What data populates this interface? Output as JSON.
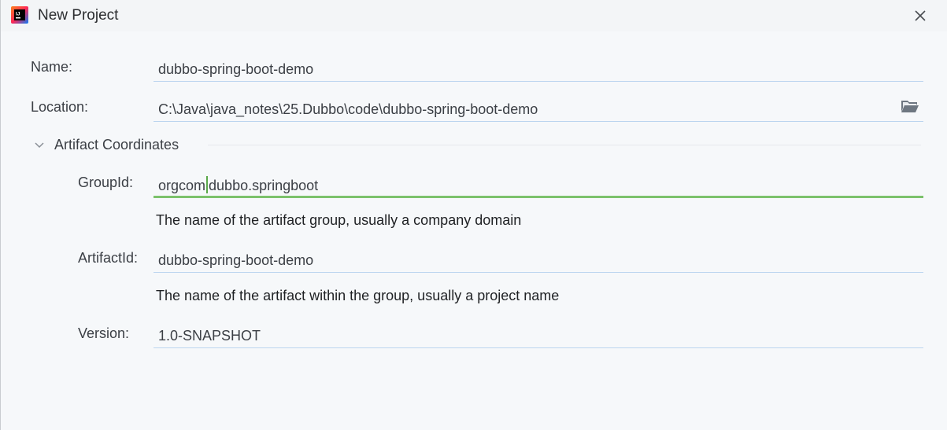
{
  "window": {
    "title": "New Project",
    "app_icon": "intellij-idea-icon",
    "close_icon": "close-icon"
  },
  "form": {
    "name_label": "Name:",
    "name_value": "dubbo-spring-boot-demo",
    "location_label": "Location:",
    "location_value": "C:\\Java\\java_notes\\25.Dubbo\\code\\dubbo-spring-boot-demo",
    "location_browse_icon": "folder-icon"
  },
  "artifact_section": {
    "title": "Artifact Coordinates",
    "expanded": true,
    "toggle_icon": "chevron-down-icon",
    "groupid_label": "GroupId:",
    "groupid_value_before_caret": "orgcom",
    "groupid_value_after_caret": "dubbo.springboot",
    "groupid_hint": "The name of the artifact group, usually a company domain",
    "artifactid_label": "ArtifactId:",
    "artifactid_value": "dubbo-spring-boot-demo",
    "artifactid_hint": "The name of the artifact within the group, usually a project name",
    "version_label": "Version:",
    "version_value": "1.0-SNAPSHOT"
  },
  "colors": {
    "background": "#f6f8fa",
    "field_underline": "#bcd5ef",
    "focus_underline": "#7cc26b",
    "text": "#3b3f45"
  }
}
